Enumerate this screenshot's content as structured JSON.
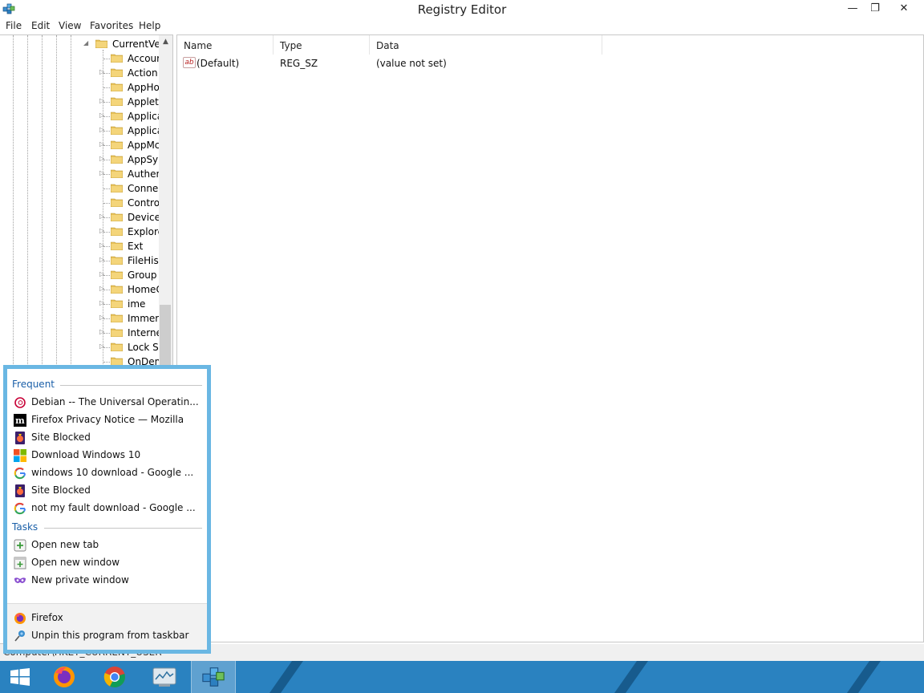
{
  "window": {
    "title": "Registry Editor"
  },
  "title_buttons": {
    "minimize": "—",
    "restore": "❐",
    "close": "✕"
  },
  "menu": [
    "File",
    "Edit",
    "View",
    "Favorites",
    "Help"
  ],
  "tree": {
    "parent": "CurrentVer",
    "parent_expander": "◢",
    "children": [
      {
        "label": "Accour",
        "expander": ""
      },
      {
        "label": "Action",
        "expander": "▷"
      },
      {
        "label": "AppHo",
        "expander": ""
      },
      {
        "label": "Applets",
        "expander": "▷"
      },
      {
        "label": "Applica",
        "expander": "▷"
      },
      {
        "label": "Applica",
        "expander": "▷"
      },
      {
        "label": "AppMc",
        "expander": "▷"
      },
      {
        "label": "AppSyr",
        "expander": "▷"
      },
      {
        "label": "Authen",
        "expander": "▷"
      },
      {
        "label": "Connec",
        "expander": ""
      },
      {
        "label": "Contro",
        "expander": ""
      },
      {
        "label": "Device/",
        "expander": "▷"
      },
      {
        "label": "Explore",
        "expander": "▷"
      },
      {
        "label": "Ext",
        "expander": "▷"
      },
      {
        "label": "FileHist",
        "expander": "▷"
      },
      {
        "label": "Group I",
        "expander": "▷"
      },
      {
        "label": "HomeC",
        "expander": "▷"
      },
      {
        "label": "ime",
        "expander": "▷"
      },
      {
        "label": "Immers",
        "expander": "▷"
      },
      {
        "label": "Interne",
        "expander": "▷"
      },
      {
        "label": "Lock Sc",
        "expander": "▷"
      },
      {
        "label": "OnDem",
        "expander": ""
      }
    ],
    "scroll_up_glyph": "▲"
  },
  "list": {
    "columns": [
      "Name",
      "Type",
      "Data"
    ],
    "rows": [
      {
        "icon": "string-value-icon",
        "icon_text": "ab",
        "name": "(Default)",
        "type": "REG_SZ",
        "data": "(value not set)"
      }
    ]
  },
  "status_bar": {
    "text": "Computer\\HKEY_CURRENT_USER"
  },
  "jumplist": {
    "frequent_heading": "Frequent",
    "frequent": [
      {
        "label": "Debian -- The Universal Operatin...",
        "icon": "debian-icon"
      },
      {
        "label": "Firefox Privacy Notice — Mozilla",
        "icon": "mozilla-icon"
      },
      {
        "label": "Site Blocked",
        "icon": "firefox-blocked-icon"
      },
      {
        "label": "Download Windows 10",
        "icon": "windows-logo-icon"
      },
      {
        "label": "windows 10 download - Google ...",
        "icon": "google-icon"
      },
      {
        "label": "Site Blocked",
        "icon": "firefox-blocked-icon"
      },
      {
        "label": "not my fault download - Google ...",
        "icon": "google-icon"
      }
    ],
    "tasks_heading": "Tasks",
    "tasks": [
      {
        "label": "Open new tab",
        "icon": "new-tab-icon"
      },
      {
        "label": "Open new window",
        "icon": "new-window-icon"
      },
      {
        "label": "New private window",
        "icon": "private-mask-icon"
      }
    ],
    "pinned": [
      {
        "label": "Firefox",
        "icon": "firefox-icon"
      },
      {
        "label": "Unpin this program from taskbar",
        "icon": "unpin-icon"
      }
    ]
  },
  "taskbar": {
    "items": [
      "start-icon",
      "firefox-icon",
      "chrome-icon",
      "resource-monitor-icon",
      "registry-editor-icon"
    ],
    "active": "registry-editor-icon"
  },
  "colors": {
    "taskbar": "#2a82c0",
    "jumplist_border": "#6ab7e3",
    "heading": "#1a5fa8",
    "folder": "#e8c25a"
  }
}
